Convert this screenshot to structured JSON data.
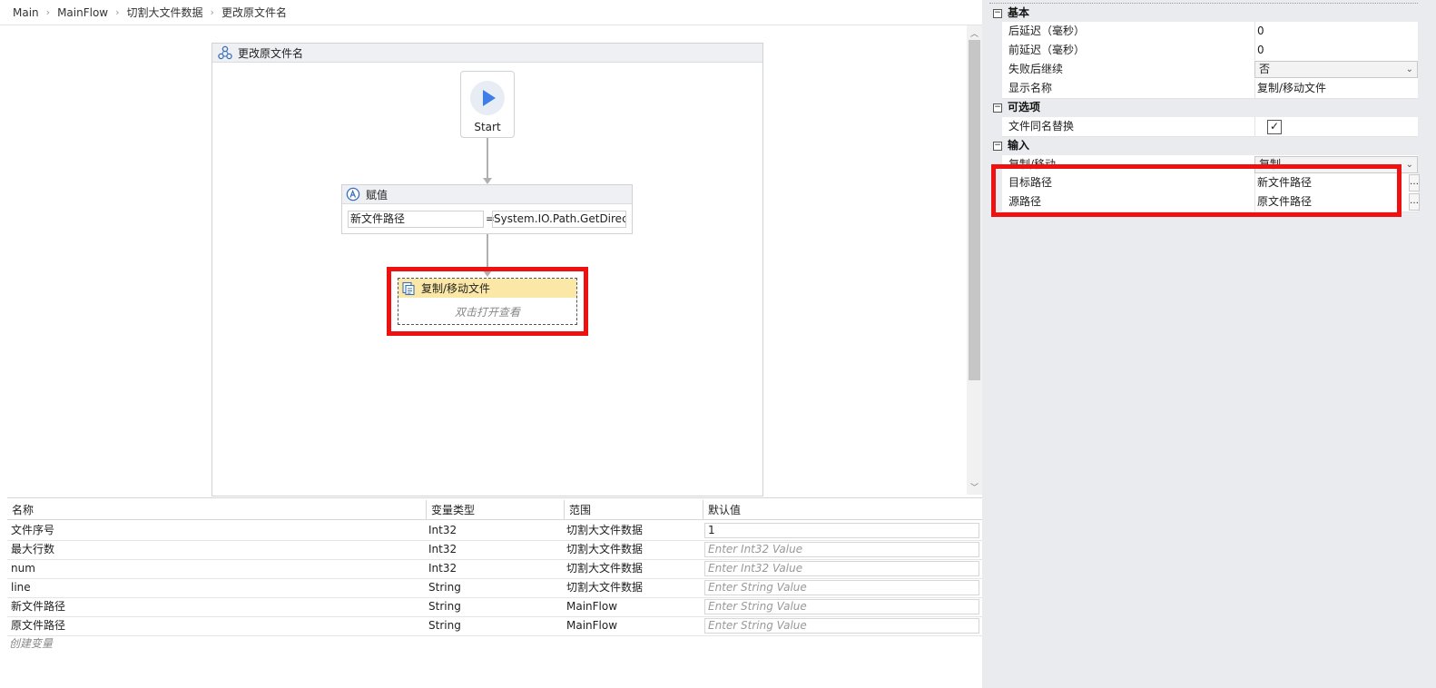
{
  "breadcrumb": [
    "Main",
    "MainFlow",
    "切割大文件数据",
    "更改原文件名"
  ],
  "sequence": {
    "title": "更改原文件名"
  },
  "start": {
    "label": "Start"
  },
  "assign": {
    "title": "赋值",
    "left": "新文件路径",
    "eq": "=",
    "right": "System.IO.Path.GetDirecto"
  },
  "copy_activity": {
    "title": "复制/移动文件",
    "hint": "双击打开查看"
  },
  "variables": {
    "headers": [
      "名称",
      "变量类型",
      "范围",
      "默认值"
    ],
    "rows": [
      {
        "name": "文件序号",
        "type": "Int32",
        "scope": "切割大文件数据",
        "default": "1",
        "placeholder": false
      },
      {
        "name": "最大行数",
        "type": "Int32",
        "scope": "切割大文件数据",
        "default": "Enter Int32 Value",
        "placeholder": true
      },
      {
        "name": "num",
        "type": "Int32",
        "scope": "切割大文件数据",
        "default": "Enter Int32 Value",
        "placeholder": true
      },
      {
        "name": "line",
        "type": "String",
        "scope": "切割大文件数据",
        "default": "Enter String Value",
        "placeholder": true
      },
      {
        "name": "新文件路径",
        "type": "String",
        "scope": "MainFlow",
        "default": "Enter String Value",
        "placeholder": true
      },
      {
        "name": "原文件路径",
        "type": "String",
        "scope": "MainFlow",
        "default": "Enter String Value",
        "placeholder": true
      }
    ],
    "create_label": "创建变量"
  },
  "properties": {
    "basic": {
      "label": "基本",
      "after_delay_label": "后延迟（毫秒）",
      "after_delay_value": "0",
      "before_delay_label": "前延迟（毫秒）",
      "before_delay_value": "0",
      "continue_on_fail_label": "失败后继续",
      "continue_on_fail_value": "否",
      "display_name_label": "显示名称",
      "display_name_value": "复制/移动文件"
    },
    "optional": {
      "label": "可选项",
      "overwrite_label": "文件同名替换",
      "overwrite_checked": "✓"
    },
    "input": {
      "label": "输入",
      "mode_label": "复制/移动",
      "mode_value": "复制",
      "target_label": "目标路径",
      "target_value": "新文件路径",
      "source_label": "源路径",
      "source_value": "原文件路径"
    }
  },
  "colors": {
    "highlight": "#ee1111",
    "activity_header": "#fbe7a6",
    "start_icon": "#3d7fe6"
  },
  "icons": {
    "sequence": "sequence-icon",
    "assign": "assign-icon",
    "copy": "file-copy-icon",
    "start": "play-icon"
  }
}
